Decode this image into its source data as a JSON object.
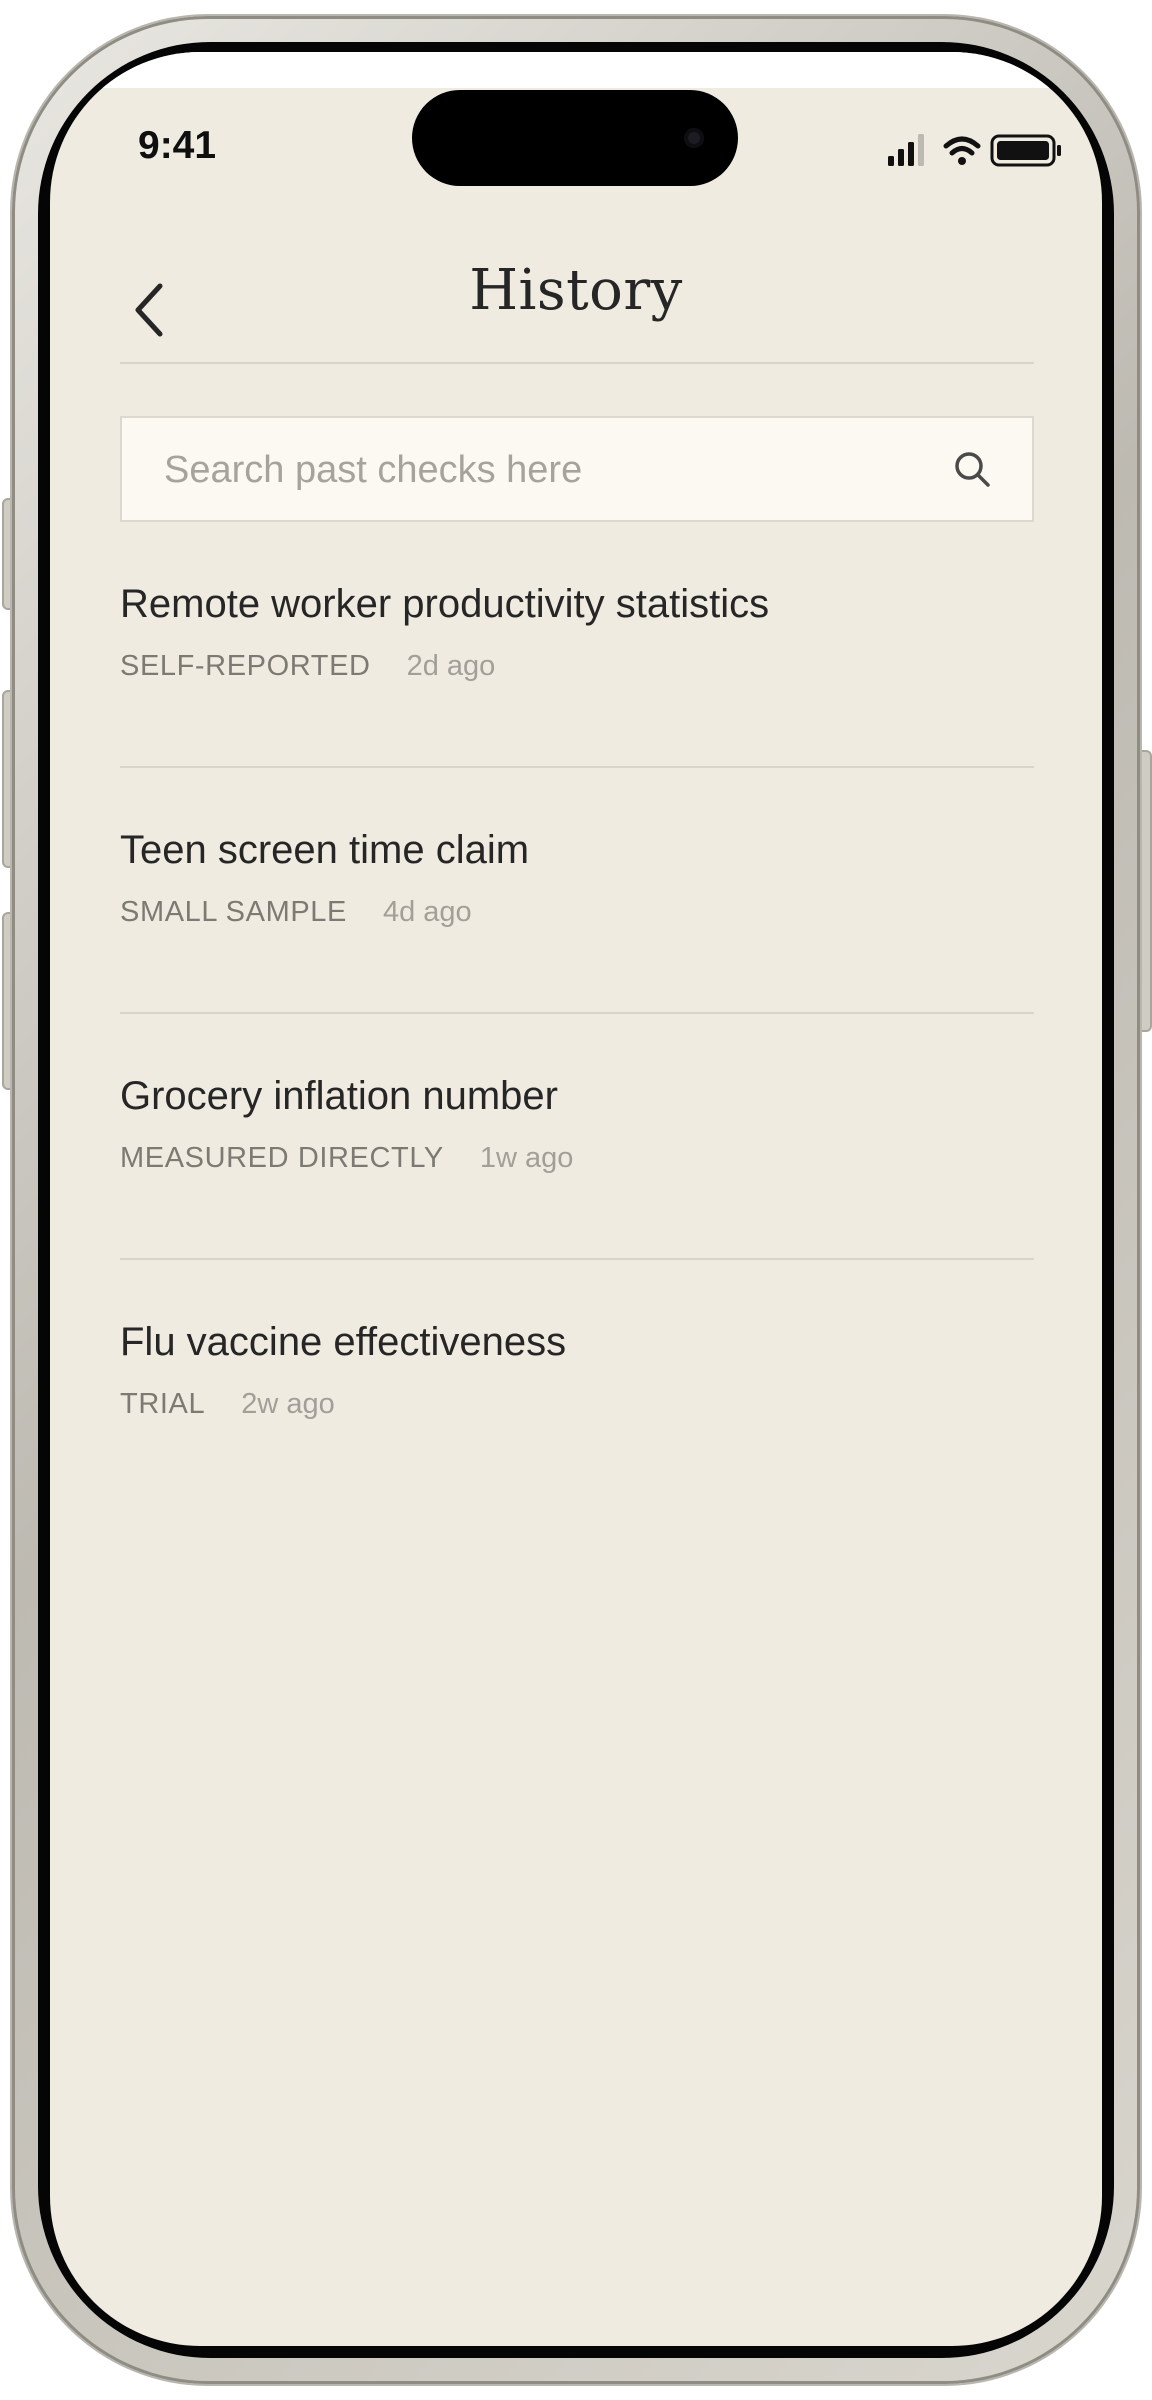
{
  "status_bar": {
    "time": "9:41"
  },
  "header": {
    "title": "History"
  },
  "search": {
    "placeholder": "Search past checks here",
    "value": ""
  },
  "history": {
    "items": [
      {
        "title": "Remote worker productivity statistics",
        "tag": "SELF-REPORTED",
        "time": "2d ago"
      },
      {
        "title": "Teen screen time claim",
        "tag": "SMALL SAMPLE",
        "time": "4d ago"
      },
      {
        "title": "Grocery inflation number",
        "tag": "MEASURED DIRECTLY",
        "time": "1w ago"
      },
      {
        "title": "Flu vaccine effectiveness",
        "tag": "TRIAL",
        "time": "2w ago"
      }
    ]
  },
  "icons": [
    "chevron-left-icon",
    "search-icon",
    "cellular-signal-icon",
    "wifi-icon",
    "battery-icon"
  ],
  "colors": {
    "background": "#efebe1",
    "search_background": "#fcf9f3",
    "text": "#262626",
    "muted": "#7d7a74"
  }
}
